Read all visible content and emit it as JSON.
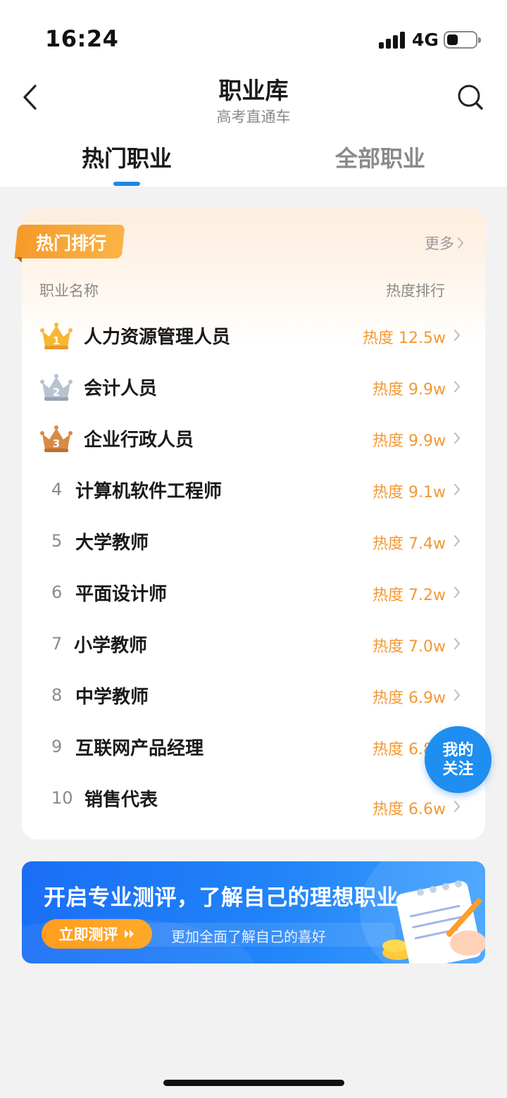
{
  "status_bar": {
    "time": "16:24",
    "network": "4G"
  },
  "nav": {
    "title": "职业库",
    "subtitle": "高考直通车",
    "back_icon": "chevron-left-icon",
    "search_icon": "search-icon"
  },
  "tabs": [
    {
      "label": "热门职业",
      "active": true
    },
    {
      "label": "全部职业",
      "active": false
    }
  ],
  "ranking_card": {
    "label": "热门排行",
    "more": "更多",
    "col_name": "职业名称",
    "col_rank": "热度排行",
    "items": [
      {
        "rank": "1",
        "name": "人力资源管理人员",
        "heat": "热度 12.5w"
      },
      {
        "rank": "2",
        "name": "会计人员",
        "heat": "热度 9.9w"
      },
      {
        "rank": "3",
        "name": "企业行政人员",
        "heat": "热度 9.9w"
      },
      {
        "rank": "4",
        "name": "计算机软件工程师",
        "heat": "热度 9.1w"
      },
      {
        "rank": "5",
        "name": "大学教师",
        "heat": "热度 7.4w"
      },
      {
        "rank": "6",
        "name": "平面设计师",
        "heat": "热度 7.2w"
      },
      {
        "rank": "7",
        "name": "小学教师",
        "heat": "热度 7.0w"
      },
      {
        "rank": "8",
        "name": "中学教师",
        "heat": "热度 6.9w"
      },
      {
        "rank": "9",
        "name": "互联网产品经理",
        "heat": "热度 6.8w"
      },
      {
        "rank": "10",
        "name": "销售代表",
        "heat": "热度 6.6w"
      }
    ]
  },
  "fab": {
    "line1": "我的",
    "line2": "关注"
  },
  "banner": {
    "title": "开启专业测评，了解自己的理想职业",
    "cta": "立即测评",
    "subtitle": "更加全面了解自己的喜好"
  },
  "colors": {
    "accent_blue": "#1e88e5",
    "heat_orange": "#f39833",
    "ribbon_orange": "#f59a2b",
    "gold": "#f7b733",
    "silver": "#b9c2cf",
    "bronze": "#d98a45"
  }
}
